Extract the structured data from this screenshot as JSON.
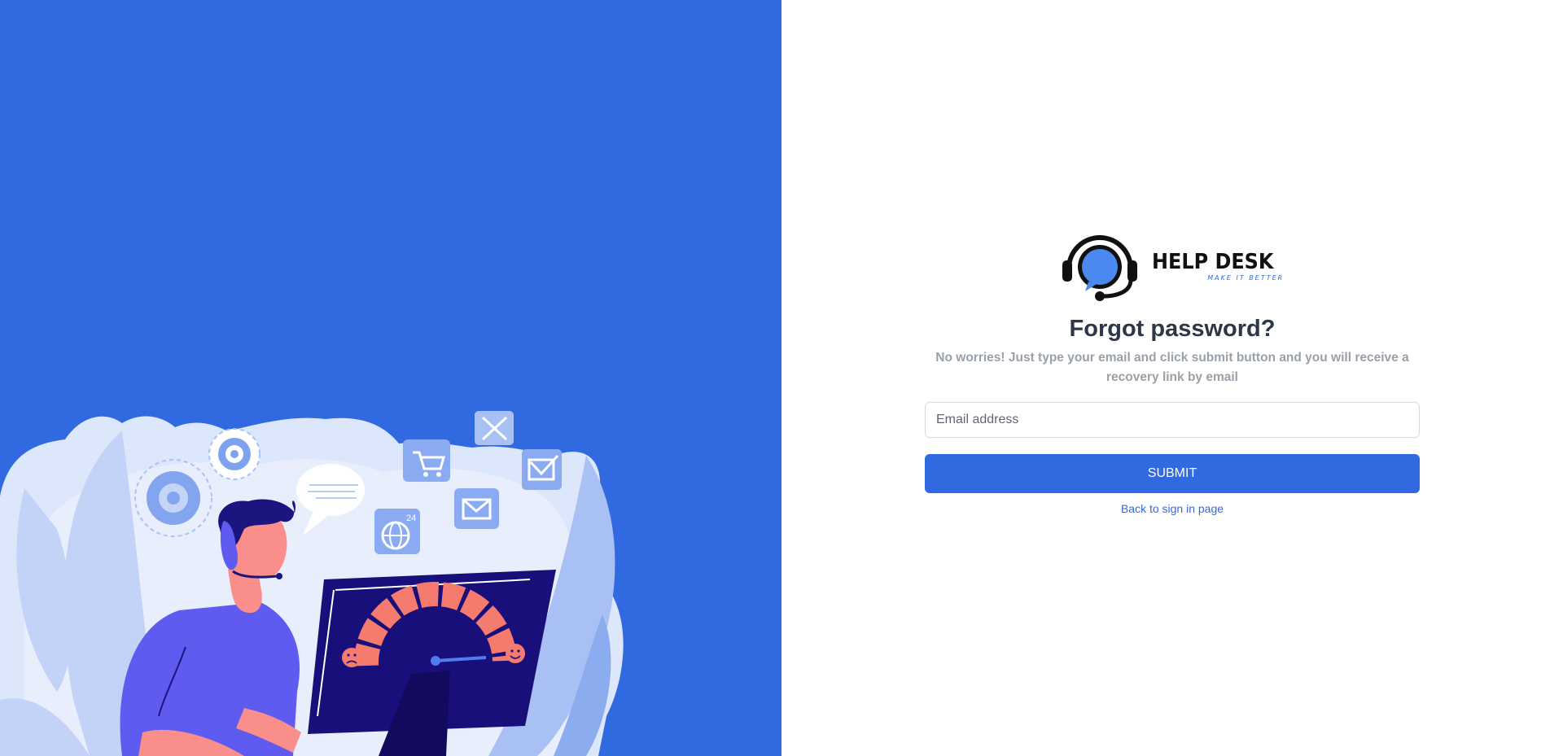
{
  "brand": {
    "name": "HELP DESK",
    "tagline": "MAKE IT BETTER",
    "accent_color": "#316ae0"
  },
  "form": {
    "title": "Forgot password?",
    "subtitle": "No worries! Just type your email and click submit button and you will receive a recovery link by email",
    "email_placeholder": "Email address",
    "email_value": "",
    "submit_label": "SUBMIT",
    "back_link_label": "Back to sign in page"
  },
  "illustration": {
    "badge_24": "24"
  },
  "colors": {
    "left_panel": "#316ae0",
    "button": "#316ae0",
    "title": "#2d3748",
    "subtitle": "#9aa0a9"
  }
}
